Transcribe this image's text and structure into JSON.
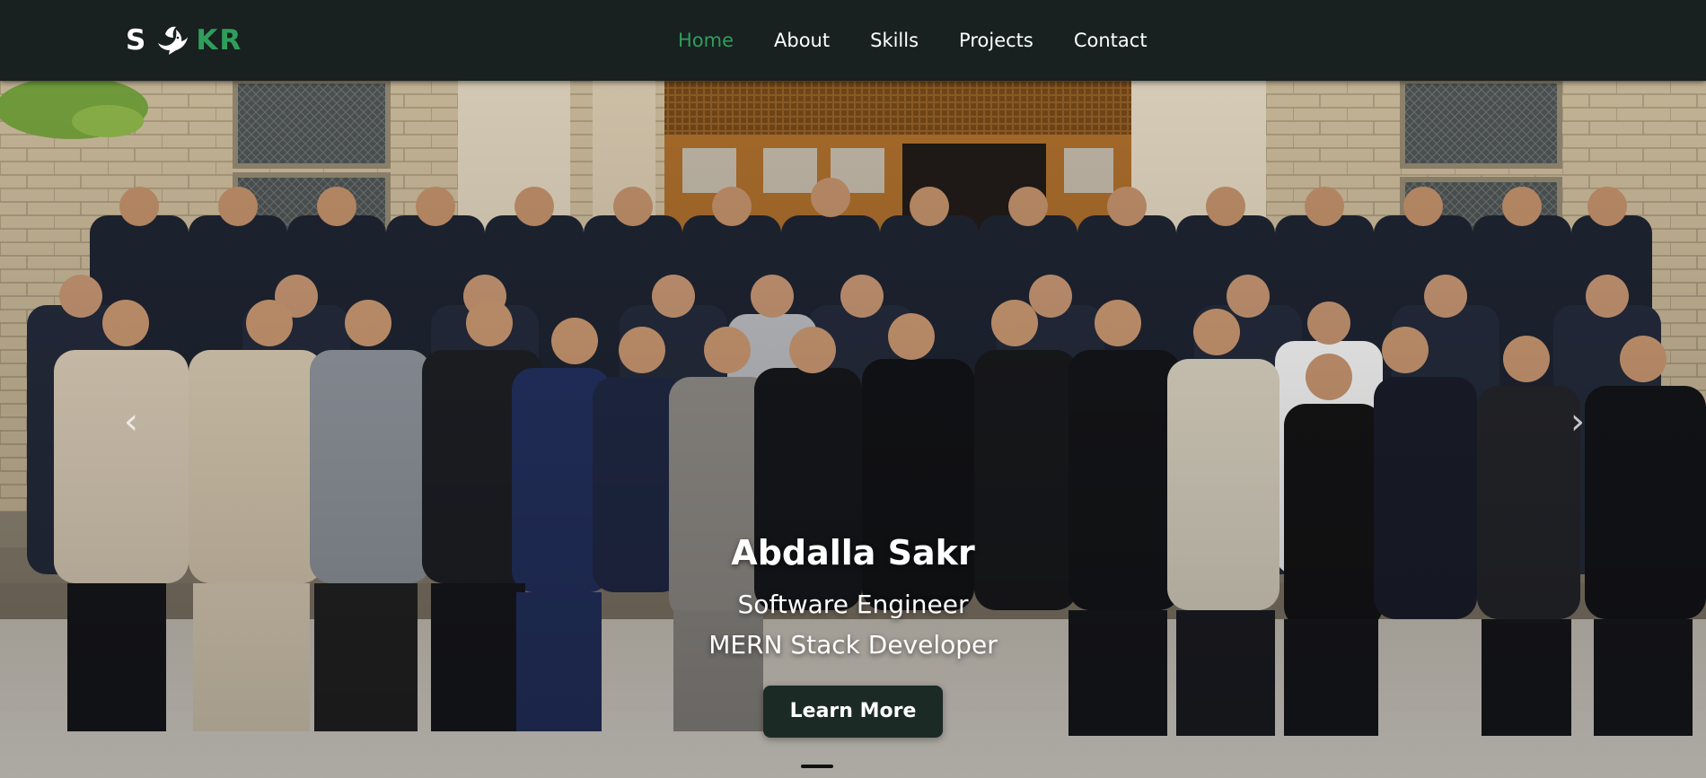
{
  "navbar": {
    "logo": {
      "left": "S",
      "icon": "dove-icon",
      "right": "KR"
    },
    "links": [
      {
        "label": "Home",
        "active": true
      },
      {
        "label": "About",
        "active": false
      },
      {
        "label": "Skills",
        "active": false
      },
      {
        "label": "Projects",
        "active": false
      },
      {
        "label": "Contact",
        "active": false
      }
    ]
  },
  "hero": {
    "name": "Abdalla Sakr",
    "role_1": "Software Engineer",
    "role_2": "MERN Stack Developer",
    "button_label": "Learn More",
    "prev_icon": "chevron-left-icon",
    "next_icon": "chevron-right-icon",
    "prev_glyph": "‹",
    "next_glyph": "›"
  },
  "colors": {
    "navbar_bg": "#182020",
    "accent_green": "#2f9e5a",
    "button_bg": "#1c2a25"
  }
}
